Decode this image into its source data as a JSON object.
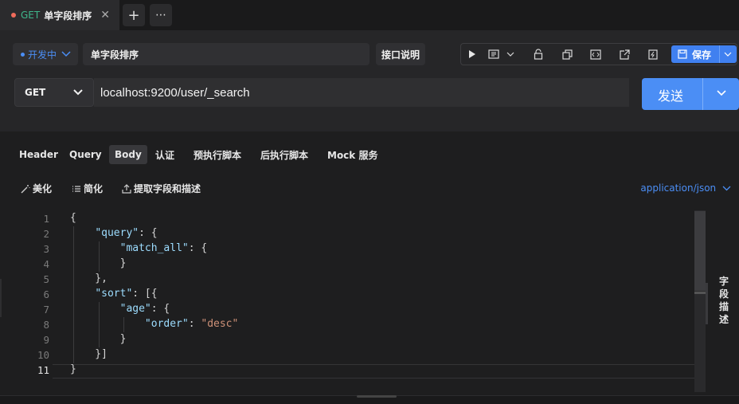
{
  "tab": {
    "method": "GET",
    "name": "单字段排序",
    "close": "✕",
    "add": "+",
    "more": "⋯",
    "status_color": "#ef6b5b"
  },
  "header": {
    "status": "开发中",
    "title": "单字段排序",
    "doc_button": "接口说明",
    "save_label": "保存",
    "toolbar_icons": [
      "play-icon",
      "doc-icon",
      "chevron-down-icon",
      "unlock-icon",
      "copy-icon",
      "code-icon",
      "share-icon",
      "lightning-icon"
    ]
  },
  "request": {
    "method": "GET",
    "url": "localhost:9200/user/_search",
    "send_label": "发送"
  },
  "req_tabs": [
    "Header",
    "Query",
    "Body",
    "认证",
    "预执行脚本",
    "后执行脚本",
    "Mock 服务"
  ],
  "active_tab": "Body",
  "body_tools": {
    "beautify": "美化",
    "simplify": "简化",
    "extract": "提取字段和描述",
    "content_type": "application/json"
  },
  "editor": {
    "line_numbers": [
      "1",
      "2",
      "3",
      "4",
      "5",
      "6",
      "7",
      "8",
      "9",
      "10",
      "11"
    ],
    "current_line": "11"
  },
  "side_panel": {
    "label": "字段描述"
  },
  "colors": {
    "accent": "#4b8ef5",
    "method_get": "#3fb68b",
    "json_key": "#9cdcfe",
    "json_string": "#ce9178"
  }
}
